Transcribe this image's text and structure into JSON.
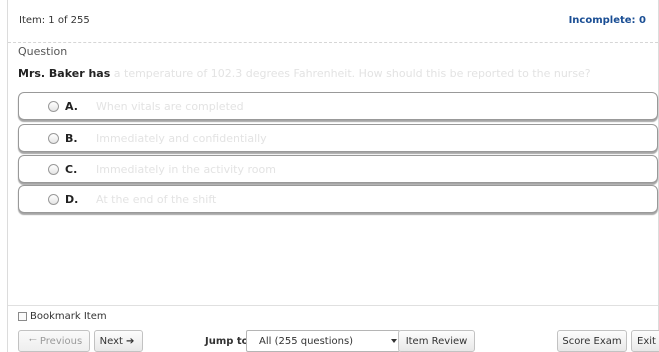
{
  "header": {
    "item_count": "Item: 1 of 255",
    "incomplete": "Incomplete: 0"
  },
  "question": {
    "heading": "Question",
    "stem_lead": "Mrs. Baker has",
    "stem_rest": " a temperature of 102.3 degrees Fahrenheit. How should this be reported to the nurse?"
  },
  "options": [
    {
      "letter": "A.",
      "text": "When vitals are completed"
    },
    {
      "letter": "B.",
      "text": "Immediately and confidentially"
    },
    {
      "letter": "C.",
      "text": "Immediately in the activity room"
    },
    {
      "letter": "D.",
      "text": "At the end of the shift"
    }
  ],
  "footer": {
    "bookmark_label": "Bookmark Item",
    "bookmark_checked": false,
    "previous_label": "Previous",
    "next_label": "Next",
    "jump_label": "Jump to:",
    "jump_selected": "All (255 questions)",
    "item_review_label": "Item Review",
    "score_exam_label": "Score Exam",
    "exit_label": "Exit"
  },
  "colors": {
    "incomplete_accent": "#1a4e94",
    "option_border": "#999999",
    "faded_text": "#e3e3e3"
  }
}
